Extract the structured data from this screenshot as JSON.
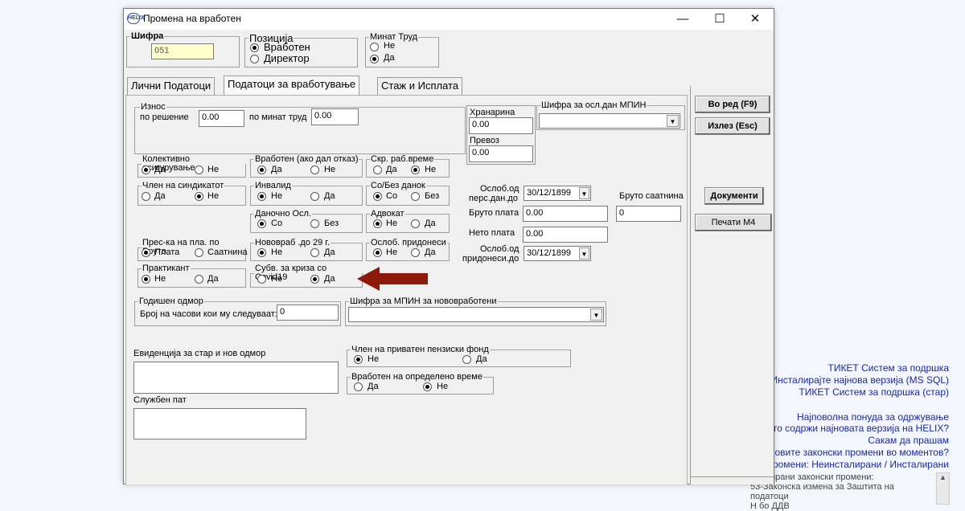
{
  "window": {
    "title": "Промена на вработен",
    "app_icon": "HELIX",
    "minimize_icon": "—",
    "maximize_icon": "☐",
    "close_icon": "✕"
  },
  "header": {
    "sifra_label": "Шифра",
    "sifra_value": "051",
    "pozicija_label": "Позиција",
    "pozicija_options": [
      "Вработен",
      "Директор"
    ],
    "pozicija_selected": "Вработен",
    "minat_trud_label": "Минат Труд",
    "minat_trud_options": [
      "Не",
      "Да"
    ],
    "minat_trud_selected": "Да"
  },
  "tabs": [
    "Лични Податоци",
    "Податоци за вработување",
    "Стаж и Исплата"
  ],
  "active_tab": "Податоци за вработување",
  "iznos": {
    "label": "Износ",
    "po_resenie_label": "по решение",
    "po_resenie_value": "0.00",
    "po_minat_trud_label": "по минат труд",
    "po_minat_trud_value": "0.00"
  },
  "hranarina_label": "Хранарина",
  "hranarina_value": "0.00",
  "prevoz_label": "Превоз",
  "prevoz_value": "0.00",
  "mpin_label": "Шифра за осл.дан МПИН",
  "groups": {
    "kolektivno": {
      "label": "Колективно осигурување",
      "opt1": "Да",
      "opt2": "Не",
      "selected": "Да"
    },
    "vraboten_otkaz": {
      "label": "Вработен (ако дал отказ)",
      "opt1": "Да",
      "opt2": "Не",
      "selected": "Да"
    },
    "skr_rab": {
      "label": "Скр. раб.време",
      "opt1": "Да",
      "opt2": "Не",
      "selected": "Не"
    },
    "sindikat": {
      "label": "Член на синдикатот",
      "opt1": "Да",
      "opt2": "Не",
      "selected": "Не"
    },
    "invalid": {
      "label": "Инвалид",
      "opt1": "Не",
      "opt2": "Да",
      "selected": "Не"
    },
    "so_bez_danok": {
      "label": "Со/Без данок",
      "opt1": "Со",
      "opt2": "Без",
      "selected": "Со"
    },
    "danocno_osl": {
      "label": "Даночно Осл.",
      "opt1": "Со",
      "opt2": "Без",
      "selected": "Со"
    },
    "advokat": {
      "label": "Адвокат",
      "opt1": "Не",
      "opt2": "Да",
      "selected": "Не"
    },
    "pres_ka": {
      "label": "Прес-ка на пла. по  Бруто",
      "opt1": "Плата",
      "opt2": "Саатнина",
      "selected": "Плата"
    },
    "novovrab": {
      "label": "Нововраб .до 29 г.",
      "opt1": "Не",
      "opt2": "Да",
      "selected": "Не"
    },
    "osl_pridonesi": {
      "label": "Ослоб. придонеси",
      "opt1": "Не",
      "opt2": "Да",
      "selected": "Не"
    },
    "praktikant": {
      "label": "Практикант",
      "opt1": "Не",
      "opt2": "Да",
      "selected": "Не"
    },
    "covid": {
      "label": "Субв. за криза со Covid19",
      "opt1": "Не",
      "opt2": "Да",
      "selected": "Да"
    },
    "penziski": {
      "label": "Член на приватен пензиски фонд",
      "opt1": "Не",
      "opt2": "Да",
      "selected": "Не"
    },
    "opredeleno": {
      "label": "Вработен на определено време",
      "opt1": "Да",
      "opt2": "Не",
      "selected": "Не"
    }
  },
  "right_fields": {
    "osl_pers_label1": "Ослоб.од",
    "osl_pers_label2": "перс.дан.до",
    "osl_pers_value": "30/12/1899",
    "bruto_plata_label": "Бруто плата",
    "bruto_plata_value": "0.00",
    "bruto_saatnina_label": "Бруто саатнина",
    "bruto_saatnina_value": "0",
    "neto_plata_label": "Нето плата",
    "neto_plata_value": "0.00",
    "osl_prid_label1": "Ослоб.од",
    "osl_prid_label2": "придонеси.до",
    "osl_prid_value": "30/12/1899"
  },
  "godisen": {
    "label": "Годишен одмор",
    "casovi_label": "Број на часови кои му следуваат:",
    "casovi_value": "0"
  },
  "mpin_novo_label": "Шифра за МПИН за нововработени",
  "evidencija_label": "Евиденција за стар и нов одмор",
  "sluzben_pat_label": "Службен пат",
  "buttons": {
    "vo_red": "Во ред (F9)",
    "izlez": "Излез (Esc)",
    "dokumenti": "Документи",
    "pecati": "Печати М4"
  },
  "side_links": [
    "ТИКЕТ Систем за подршка",
    "Инсталирајте најнова верзија (MS SQL)",
    "ТИКЕТ Систем за подршка (стар)",
    "Најповолна понуда за одржување",
    "Што содржи најновата верзија на HELIX?",
    "Сакам да прашам",
    "најновите законски промени во моментов?",
    "и промени: Неинсталирани / Инсталирани"
  ],
  "side_list": [
    "сталирани законски промени:",
    "53-Законска измена за Заштита на",
    "податоци",
    "Н                    бо ДДВ"
  ],
  "colors": {
    "arrow": "#8b1a0a",
    "link": "#1a2aa0",
    "background": "#f3f6fc"
  }
}
